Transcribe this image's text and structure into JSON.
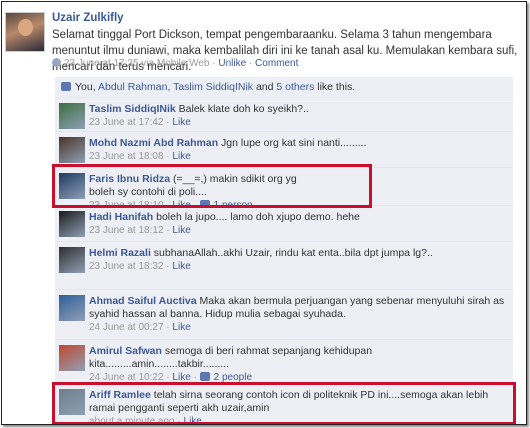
{
  "post": {
    "author": "Uzair Zulkifly",
    "text": "Selamat tinggal Port Dickson, tempat pengembaraanku. Selama 3 tahun mengembara menuntut ilmu duniawi, maka kembalilah diri ini ke tanah asal ku. Memulakan kembara sufi, mencari dan terus mencari.",
    "time": "23 June at 17:25 via Mobile Web",
    "unlike": "Unlike",
    "comment": "Comment"
  },
  "likes": {
    "prefix": "You, ",
    "names": "Abdul Rahman, Taslim SiddiqINik",
    "and": " and ",
    "others": "5 others",
    "suffix": " like this."
  },
  "comments": [
    {
      "name": "Taslim SiddiqINik",
      "text": "Balek klate doh ko syeikh?..",
      "time": "23 June at 17:42",
      "like": "Like",
      "count": ""
    },
    {
      "name": "Mohd Nazmi Abd Rahman",
      "text": "Jgn lupe org kat sini nanti.........",
      "time": "23 June at 18:08",
      "like": "Like",
      "count": ""
    },
    {
      "name": "Faris Ibnu Ridza",
      "text": "(=__=,) makin sdikit org yg boleh sy contohi di poli....",
      "time": "23 June at 18:10",
      "like": "Like",
      "count": "1 person"
    },
    {
      "name": "Hadi Hanifah",
      "text": "boleh la jupo.... lamo doh xjupo demo. hehe",
      "time": "23 June at 18:12",
      "like": "Like",
      "count": ""
    },
    {
      "name": "Helmi Razali",
      "text": "subhanaAllah..akhi Uzair, rindu kat enta..bila dpt jumpa lg?..",
      "time": "23 June at 18:32",
      "like": "Like",
      "count": ""
    },
    {
      "name": "Ahmad Saiful Auctiva",
      "text": "Maka akan bermula perjuangan yang sebenar menyuluhi sirah as syahid hassan al banna. Hidup mulia sebagai syuhada.",
      "time": "24 June at 00:27",
      "like": "Like",
      "count": ""
    },
    {
      "name": "Amirul Safwan",
      "text": "semoga di beri rahmat sepanjang kehidupan kita.........amin........takbir.........",
      "time": "24 June at 10:22",
      "like": "Like",
      "count": "2 people"
    },
    {
      "name": "Ariff Ramlee",
      "text": "telah sirna seorang contoh icon di politeknik PD ini....semoga akan lebih ramai pengganti seperti akh uzair,amin",
      "time": "about a minute ago",
      "like": "Like",
      "count": ""
    }
  ],
  "colors": {
    "link": "#3b5998",
    "highlight": "#c8102e",
    "comment_bg": "#edeff4"
  },
  "icons": {
    "globe": "globe-icon",
    "like": "thumbs-up-icon"
  }
}
